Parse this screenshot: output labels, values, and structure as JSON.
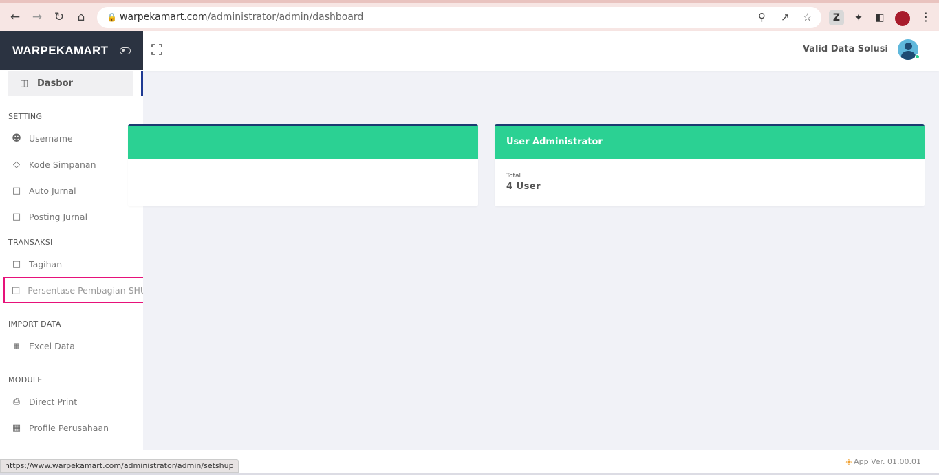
{
  "browser": {
    "url_host": "warpekamart.com",
    "url_path": "/administrator/admin/dashboard",
    "status_url": "https://www.warpekamart.com/administrator/admin/setshup",
    "ext_label": "Z"
  },
  "sidebar": {
    "brand": "WARPEKAMART",
    "active_item": "Dasbor",
    "sections": {
      "setting": "SETTING",
      "transaksi": "TRANSAKSI",
      "import": "IMPORT DATA",
      "module": "MODULE"
    },
    "items": {
      "username": "Username",
      "kode_simpanan": "Kode Simpanan",
      "auto_jurnal": "Auto Jurnal",
      "posting_jurnal": "Posting Jurnal",
      "tagihan": "Tagihan",
      "persentase": "Persentase Pembagian SHU",
      "excel_data": "Excel Data",
      "direct_print": "Direct Print",
      "profile_perusahaan": "Profile Perusahaan"
    }
  },
  "topbar": {
    "user_name": "Valid Data Solusi"
  },
  "cards": {
    "user_admin": {
      "title": "User Administrator",
      "label": "Total",
      "value": "4 User"
    }
  },
  "footer": {
    "app_version": "App Ver. 01.00.01"
  },
  "colors": {
    "card_header": "#2bd193",
    "sidebar_brand_bg": "#2b3341",
    "highlight_border": "#e6127a"
  }
}
